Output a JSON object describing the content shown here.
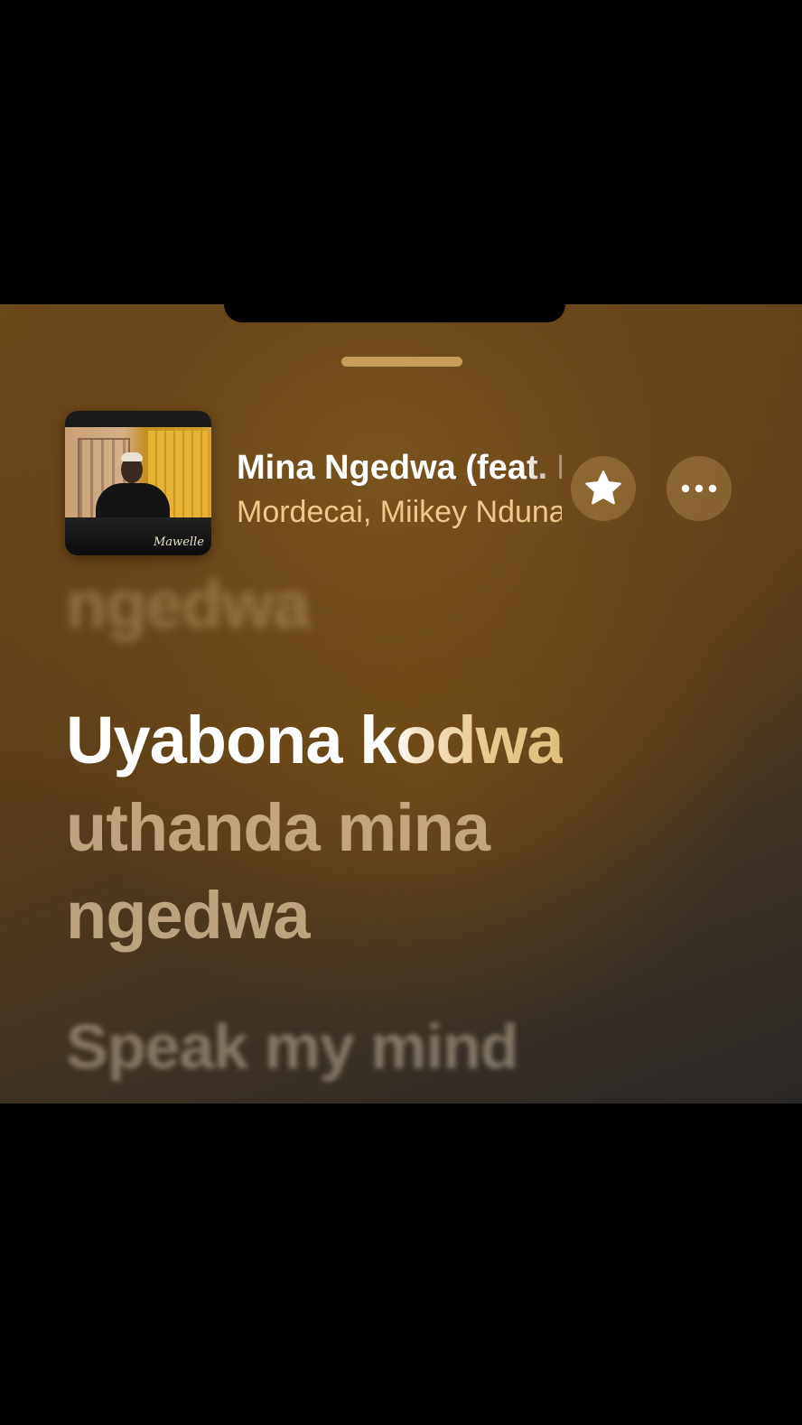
{
  "now_playing": {
    "title": "Mina Ngedwa (feat. Miikey Nduna)",
    "artist": "Mordecai, Miikey Nduna",
    "artwork_signature": "Mawelle"
  },
  "actions": {
    "favorite_icon": "star-icon",
    "more_icon": "ellipsis-icon"
  },
  "lyrics": {
    "previous": "ngedwa",
    "current_sung": "Uyabona k",
    "current_upcoming": "odwa",
    "current_line2": "uthanda mina",
    "current_line3": "ngedwa",
    "next": "Speak my mind"
  },
  "colors": {
    "background": "#6e4a19",
    "accent": "#f0c98a",
    "grabber": "#d6aa64"
  }
}
